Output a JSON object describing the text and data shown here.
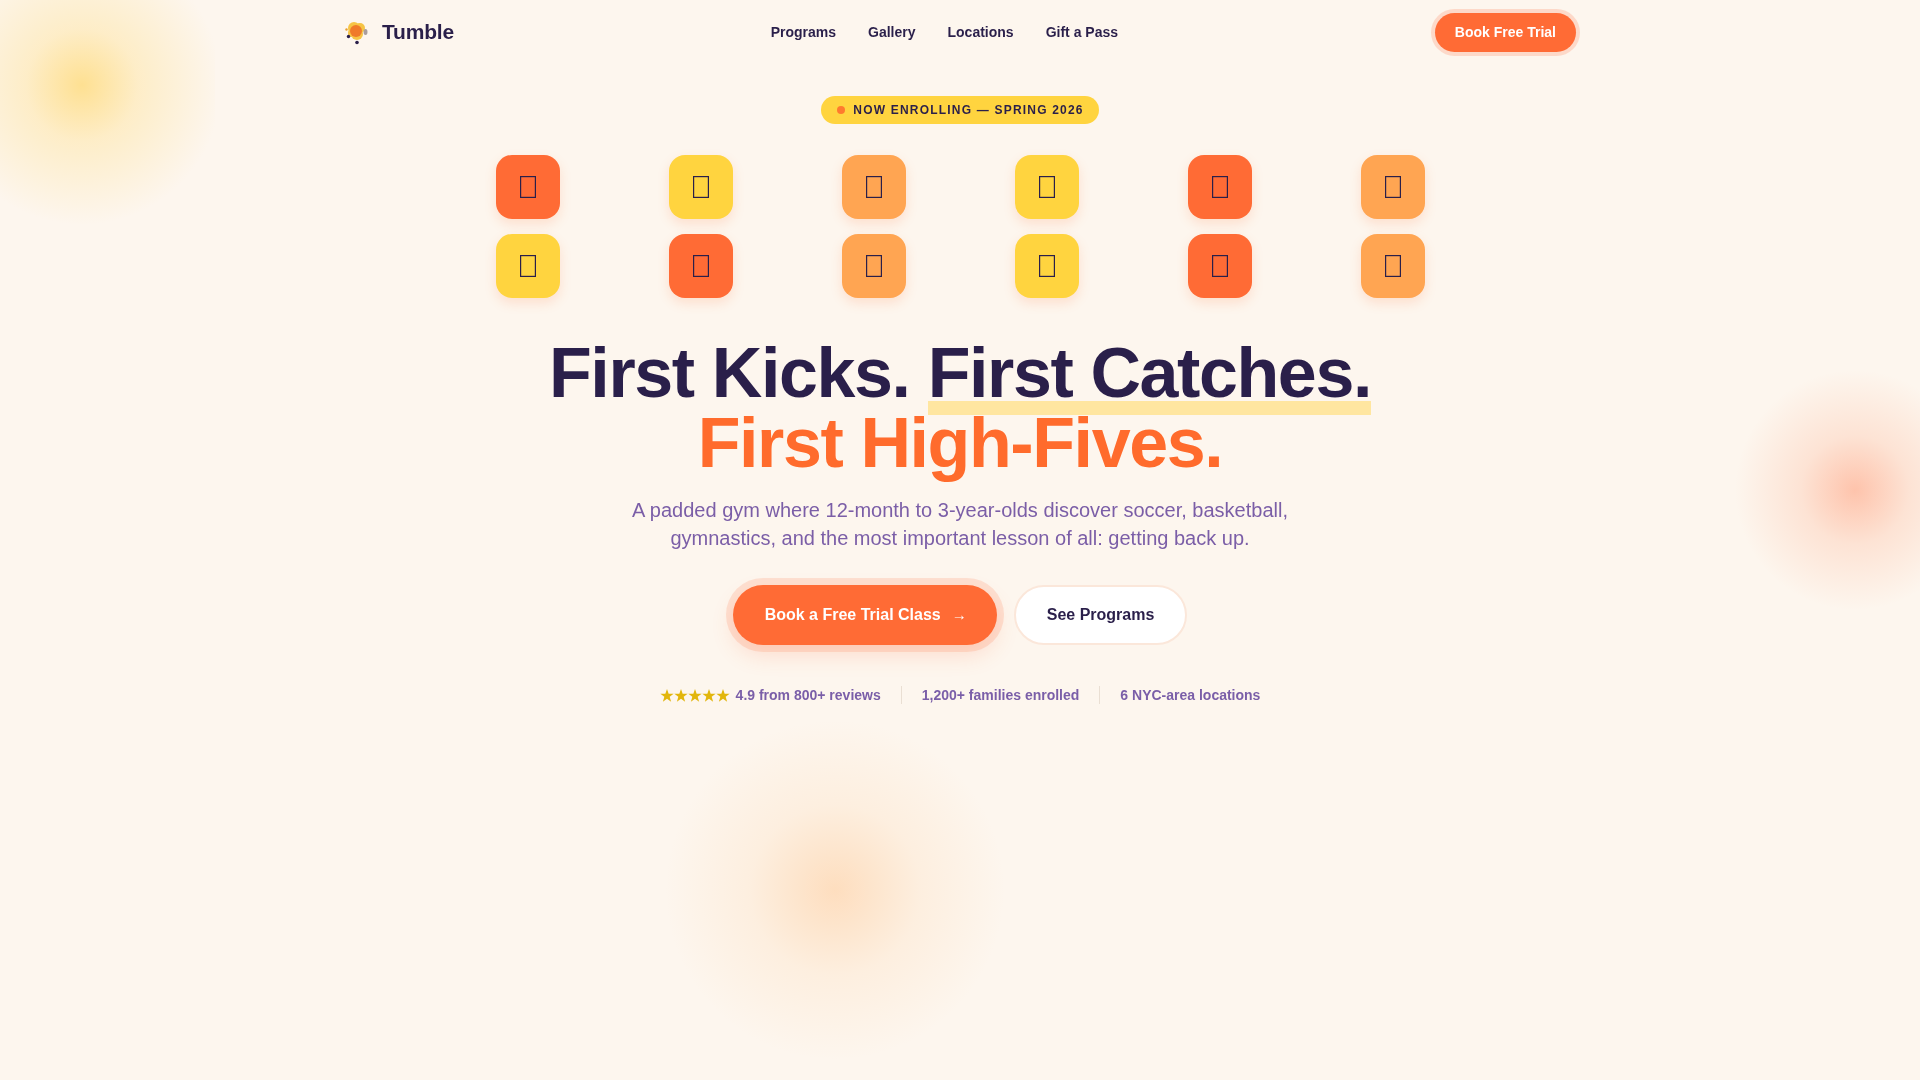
{
  "header": {
    "logo_text": "Tumble",
    "nav": [
      "Programs",
      "Gallery",
      "Locations",
      "Gift a Pass"
    ],
    "cta": "Book Free Trial"
  },
  "badge": {
    "text": "NOW ENROLLING — SPRING 2026"
  },
  "tiles": [
    {
      "color": "#ff6b35"
    },
    {
      "color": "#ffd43f"
    },
    {
      "color": "#ffa552"
    },
    {
      "color": "#ffd43f"
    },
    {
      "color": "#ff6b35"
    },
    {
      "color": "#ffa552"
    },
    {
      "color": "#ffd43f"
    },
    {
      "color": "#ff6b35"
    },
    {
      "color": "#ffa552"
    },
    {
      "color": "#ffd43f"
    },
    {
      "color": "#ff6b35"
    },
    {
      "color": "#ffa552"
    }
  ],
  "headline": {
    "parts": [
      {
        "kind": "plain",
        "text": "First Kicks."
      },
      {
        "kind": "highlight",
        "text": "First Catches."
      },
      {
        "kind": "accent",
        "text": "First High-Fives."
      }
    ]
  },
  "subtitle": "A padded gym where 12-month to 3-year-olds discover soccer, basketball, gymnastics, and the most important lesson of all: getting back up.",
  "actions": [
    {
      "kind": "primary",
      "label": "Book a Free Trial Class",
      "arrow": "→"
    },
    {
      "kind": "secondary",
      "label": "See Programs"
    }
  ],
  "stats": [
    {
      "kind": "rating",
      "stars": 5,
      "text": "4.9 from 800+ reviews"
    },
    {
      "kind": "plain",
      "text": "1,200+ families enrolled"
    },
    {
      "kind": "plain",
      "text": "6 NYC-area locations"
    }
  ]
}
